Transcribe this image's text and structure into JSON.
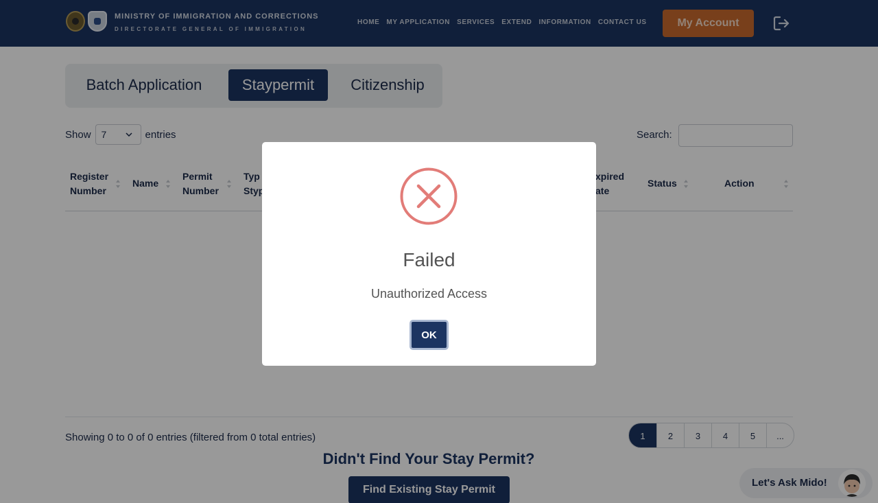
{
  "header": {
    "brand_line1": "MINISTRY OF IMMIGRATION AND CORRECTIONS",
    "brand_line2": "DIRECTORATE GENERAL OF IMMIGRATION",
    "nav": [
      "HOME",
      "MY APPLICATION",
      "SERVICES",
      "EXTEND",
      "INFORMATION",
      "CONTACT US"
    ],
    "account_label": "My Account",
    "logout_icon": "logout-icon"
  },
  "tabs": [
    "Batch Application",
    "Staypermit",
    "Citizenship"
  ],
  "active_tab": "Staypermit",
  "entries": {
    "show_label": "Show",
    "selected": "7",
    "entries_label": "entries",
    "search_label": "Search:",
    "search_value": ""
  },
  "table": {
    "columns": [
      {
        "line1": "Register",
        "line2": "Number"
      },
      {
        "line1": "Name",
        "line2": ""
      },
      {
        "line1": "Permit",
        "line2": "Number"
      },
      {
        "line1": "Typ",
        "line2": "Styp"
      },
      {
        "line1": "xpired",
        "line2": "ate"
      },
      {
        "line1": "Status",
        "line2": ""
      },
      {
        "line1": "Action",
        "line2": ""
      }
    ],
    "rows": []
  },
  "footer": {
    "showing": "Showing 0 to 0 of 0 entries (filtered from 0 total entries)",
    "pages": [
      "1",
      "2",
      "3",
      "4",
      "5",
      "..."
    ],
    "active_page": "1",
    "didnt_find": "Didn't Find Your Stay Permit?",
    "find_button": "Find Existing Stay Permit",
    "chat_label": "Let's Ask Mido!"
  },
  "modal": {
    "icon": "error-x-icon",
    "title": "Failed",
    "message": "Unauthorized Access",
    "ok_label": "OK"
  },
  "colors": {
    "primary": "#1c3461",
    "accent": "#c96a2d",
    "error": "#e27c78"
  }
}
